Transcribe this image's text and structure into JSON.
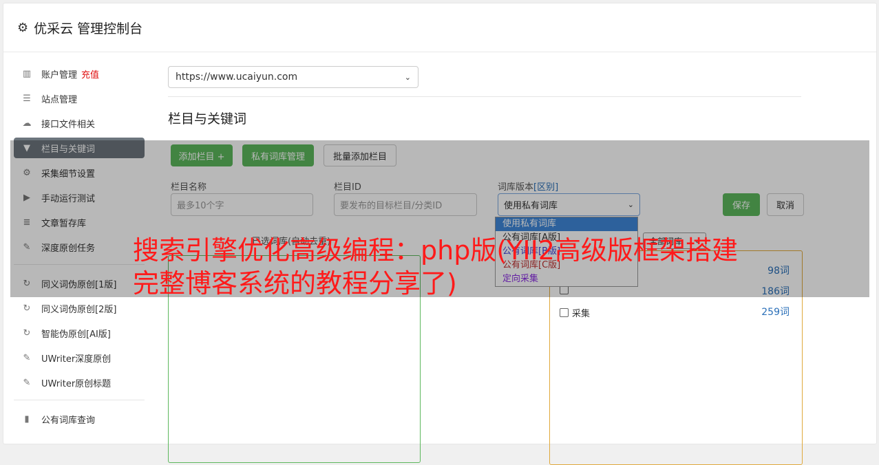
{
  "header": {
    "title": "优采云 管理控制台",
    "icon": "gear-icon"
  },
  "sidebar": {
    "items": [
      {
        "label": "账户管理",
        "extra": "充值",
        "icon": "bar-chart-icon"
      },
      {
        "label": "站点管理",
        "icon": "server-icon"
      },
      {
        "label": "接口文件相关",
        "icon": "cloud-upload-icon"
      },
      {
        "label": "栏目与关键词",
        "icon": "filter-icon",
        "active": true
      },
      {
        "label": "采集细节设置",
        "icon": "cogs-icon"
      },
      {
        "label": "手动运行测试",
        "icon": "play-icon"
      },
      {
        "label": "文章暂存库",
        "icon": "database-icon"
      },
      {
        "label": "深度原创任务",
        "icon": "edit-icon"
      }
    ],
    "items2": [
      {
        "label": "同义词伪原创[1版]",
        "icon": "refresh-icon"
      },
      {
        "label": "同义词伪原创[2版]",
        "icon": "refresh-icon"
      },
      {
        "label": "智能伪原创[AI版]",
        "icon": "refresh-icon"
      },
      {
        "label": "UWriter深度原创",
        "icon": "edit-icon"
      },
      {
        "label": "UWriter原创标题",
        "icon": "edit-icon"
      }
    ],
    "items3": [
      {
        "label": "公有词库查询",
        "icon": "book-icon"
      }
    ]
  },
  "main": {
    "site_select": "https://www.ucaiyun.com",
    "section_title": "栏目与关键词",
    "buttons": {
      "add": "添加栏目 +",
      "private": "私有词库管理",
      "batch": "批量添加栏目",
      "save": "保存",
      "cancel": "取消"
    },
    "fields": {
      "name_label": "栏目名称",
      "name_placeholder": "最多10个字",
      "id_label": "栏目ID",
      "id_placeholder": "要发布的目标栏目/分类ID",
      "version_label": "词库版本",
      "version_link": "[区别]",
      "version_value": "使用私有词库"
    },
    "dropdown_options": [
      "使用私有词库",
      "公有词库[A版]",
      "公有词库[B版]",
      "公有词库[C版]",
      "定向采集"
    ],
    "panel_label": "已选词库(自动去重)",
    "filter_select": "全部词库",
    "libs": [
      {
        "name": "",
        "count": "98词"
      },
      {
        "name": "",
        "count": "186词"
      },
      {
        "name": "采集",
        "count": "259词"
      }
    ]
  },
  "watermark": "搜索引擎优化高级编程：php版(YII2高级版框架搭建完整博客系统的教程分享了)",
  "colors": {
    "active_nav": "#6c757d",
    "green": "#5cb85c",
    "watermark": "#ff1a1a"
  }
}
